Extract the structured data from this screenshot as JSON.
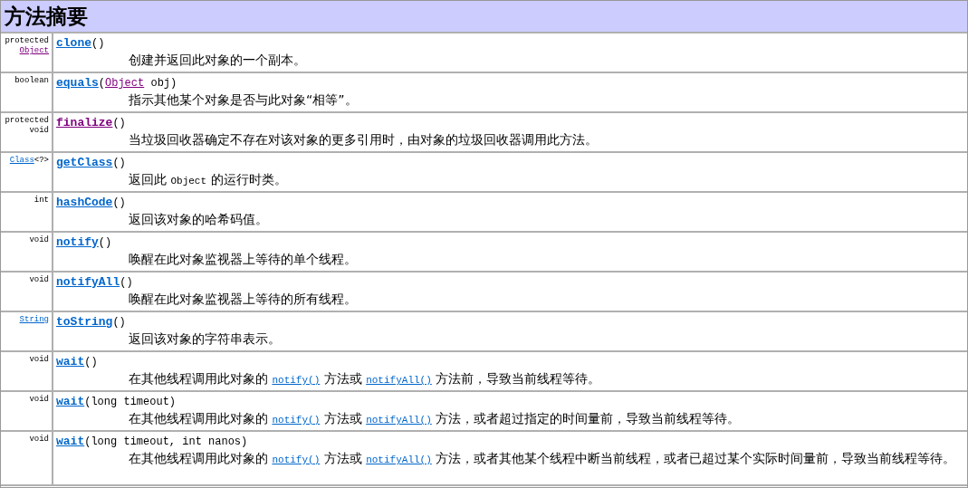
{
  "title": "方法摘要",
  "rows": [
    {
      "modifier": "protected",
      "type": [
        {
          "kind": "link",
          "text": "Object",
          "visited": true
        }
      ],
      "name": "clone",
      "visited": false,
      "params": [
        {
          "kind": "text",
          "text": "()"
        }
      ],
      "description": [
        {
          "kind": "text",
          "text": "创建并返回此对象的一个副本。"
        }
      ]
    },
    {
      "type": [
        {
          "kind": "text",
          "text": "boolean"
        }
      ],
      "name": "equals",
      "visited": false,
      "params": [
        {
          "kind": "text",
          "text": "("
        },
        {
          "kind": "link",
          "text": "Object",
          "visited": true
        },
        {
          "kind": "text",
          "text": " obj)"
        }
      ],
      "description": [
        {
          "kind": "text",
          "text": "指示其他某个对象是否与此对象“相等”。"
        }
      ]
    },
    {
      "modifier": "protected",
      "type": [
        {
          "kind": "text",
          "text": "void"
        }
      ],
      "name": "finalize",
      "visited": true,
      "params": [
        {
          "kind": "text",
          "text": "()"
        }
      ],
      "description": [
        {
          "kind": "text",
          "text": "当垃圾回收器确定不存在对该对象的更多引用时，由对象的垃圾回收器调用此方法。"
        }
      ]
    },
    {
      "type": [
        {
          "kind": "link",
          "text": "Class",
          "visited": false
        },
        {
          "kind": "text",
          "text": "<?>"
        }
      ],
      "name": "getClass",
      "visited": false,
      "params": [
        {
          "kind": "text",
          "text": "()"
        }
      ],
      "description": [
        {
          "kind": "text",
          "text": "返回此 "
        },
        {
          "kind": "code",
          "text": "Object"
        },
        {
          "kind": "text",
          "text": " 的运行时类。"
        }
      ]
    },
    {
      "type": [
        {
          "kind": "text",
          "text": "int"
        }
      ],
      "name": "hashCode",
      "visited": false,
      "params": [
        {
          "kind": "text",
          "text": "()"
        }
      ],
      "description": [
        {
          "kind": "text",
          "text": "返回该对象的哈希码值。"
        }
      ]
    },
    {
      "type": [
        {
          "kind": "text",
          "text": "void"
        }
      ],
      "name": "notify",
      "visited": false,
      "params": [
        {
          "kind": "text",
          "text": "()"
        }
      ],
      "description": [
        {
          "kind": "text",
          "text": "唤醒在此对象监视器上等待的单个线程。"
        }
      ]
    },
    {
      "type": [
        {
          "kind": "text",
          "text": "void"
        }
      ],
      "name": "notifyAll",
      "visited": false,
      "params": [
        {
          "kind": "text",
          "text": "()"
        }
      ],
      "description": [
        {
          "kind": "text",
          "text": "唤醒在此对象监视器上等待的所有线程。"
        }
      ]
    },
    {
      "type": [
        {
          "kind": "link",
          "text": "String",
          "visited": false
        }
      ],
      "name": "toString",
      "visited": false,
      "params": [
        {
          "kind": "text",
          "text": "()"
        }
      ],
      "description": [
        {
          "kind": "text",
          "text": "返回该对象的字符串表示。"
        }
      ]
    },
    {
      "type": [
        {
          "kind": "text",
          "text": "void"
        }
      ],
      "name": "wait",
      "visited": false,
      "params": [
        {
          "kind": "text",
          "text": "()"
        }
      ],
      "description": [
        {
          "kind": "text",
          "text": "在其他线程调用此对象的 "
        },
        {
          "kind": "link",
          "text": "notify()",
          "visited": false
        },
        {
          "kind": "text",
          "text": " 方法或 "
        },
        {
          "kind": "link",
          "text": "notifyAll()",
          "visited": false
        },
        {
          "kind": "text",
          "text": " 方法前，导致当前线程等待。"
        }
      ]
    },
    {
      "type": [
        {
          "kind": "text",
          "text": "void"
        }
      ],
      "name": "wait",
      "visited": false,
      "params": [
        {
          "kind": "text",
          "text": "(long timeout)"
        }
      ],
      "description": [
        {
          "kind": "text",
          "text": "在其他线程调用此对象的 "
        },
        {
          "kind": "link",
          "text": "notify()",
          "visited": false
        },
        {
          "kind": "text",
          "text": " 方法或 "
        },
        {
          "kind": "link",
          "text": "notifyAll()",
          "visited": false
        },
        {
          "kind": "text",
          "text": " 方法，或者超过指定的时间量前，导致当前线程等待。"
        }
      ]
    },
    {
      "type": [
        {
          "kind": "text",
          "text": "void"
        }
      ],
      "name": "wait",
      "visited": false,
      "params": [
        {
          "kind": "text",
          "text": "(long timeout, int nanos)"
        }
      ],
      "description": [
        {
          "kind": "text",
          "text": "在其他线程调用此对象的 "
        },
        {
          "kind": "link",
          "text": "notify()",
          "visited": false
        },
        {
          "kind": "text",
          "text": " 方法或 "
        },
        {
          "kind": "link",
          "text": "notifyAll()",
          "visited": false
        },
        {
          "kind": "text",
          "text": " 方法，或者其他某个线程中断当前线程，或者已超过某个实际时间量前，导致当前线程等待。"
        }
      ]
    }
  ]
}
